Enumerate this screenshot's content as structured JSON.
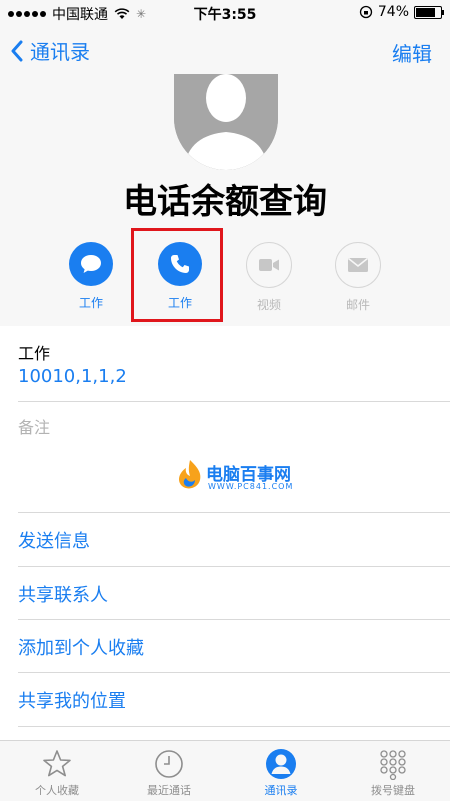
{
  "status_bar": {
    "carrier": "中国联通",
    "time": "下午3:55",
    "battery_text": "74%",
    "battery_level": 0.74
  },
  "nav": {
    "back_label": "通讯录",
    "edit_label": "编辑"
  },
  "contact": {
    "name": "电话余额查询"
  },
  "actions": [
    {
      "label": "工作",
      "icon": "message-icon",
      "state": "active"
    },
    {
      "label": "工作",
      "icon": "phone-icon",
      "state": "active"
    },
    {
      "label": "视频",
      "icon": "video-icon",
      "state": "disabled"
    },
    {
      "label": "邮件",
      "icon": "mail-icon",
      "state": "disabled"
    }
  ],
  "phone": {
    "label": "工作",
    "number": "10010,1,1,2"
  },
  "notes": {
    "label": "备注"
  },
  "watermark": {
    "title": "电脑百事网",
    "url": "WWW.PC841.COM"
  },
  "links": [
    "发送信息",
    "共享联系人",
    "添加到个人收藏",
    "共享我的位置"
  ],
  "tabs": [
    {
      "label": "个人收藏",
      "icon": "star-icon",
      "active": false
    },
    {
      "label": "最近通话",
      "icon": "clock-icon",
      "active": false
    },
    {
      "label": "通讯录",
      "icon": "person-icon",
      "active": true
    },
    {
      "label": "拨号键盘",
      "icon": "keypad-icon",
      "active": false
    }
  ],
  "colors": {
    "accent": "#1a7ef0",
    "highlight": "#e0161c",
    "disabled": "#b9b9b9"
  }
}
